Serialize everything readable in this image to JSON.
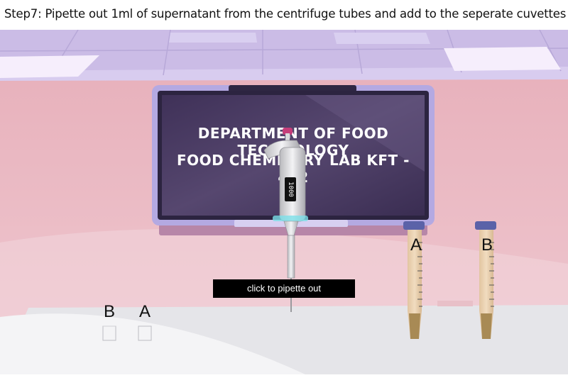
{
  "instruction": {
    "text": "Step7: Pipette out 1ml of supernatant from the centrifuge tubes and add to the seperate cuvettes"
  },
  "screen": {
    "line1": "DEPARTMENT OF FOOD TECHNOLOGY",
    "line2": "FOOD CHEMISTRY LAB KFT - 452"
  },
  "pipette": {
    "volume_display": "1000"
  },
  "cuvettes": [
    {
      "label": "B"
    },
    {
      "label": "A"
    }
  ],
  "centrifuge_tubes": [
    {
      "label": "A"
    },
    {
      "label": "B"
    }
  ],
  "action_button": {
    "label": "click to pipette out"
  },
  "colors": {
    "wall": "#e7b9c3",
    "ceiling": "#cdbde8",
    "screen_frame": "#b3a9e0",
    "screen_inner": "#4a3b66",
    "bench": "#e6e6ea",
    "tube_cap": "#5b62a8",
    "button_bg": "#000000"
  }
}
